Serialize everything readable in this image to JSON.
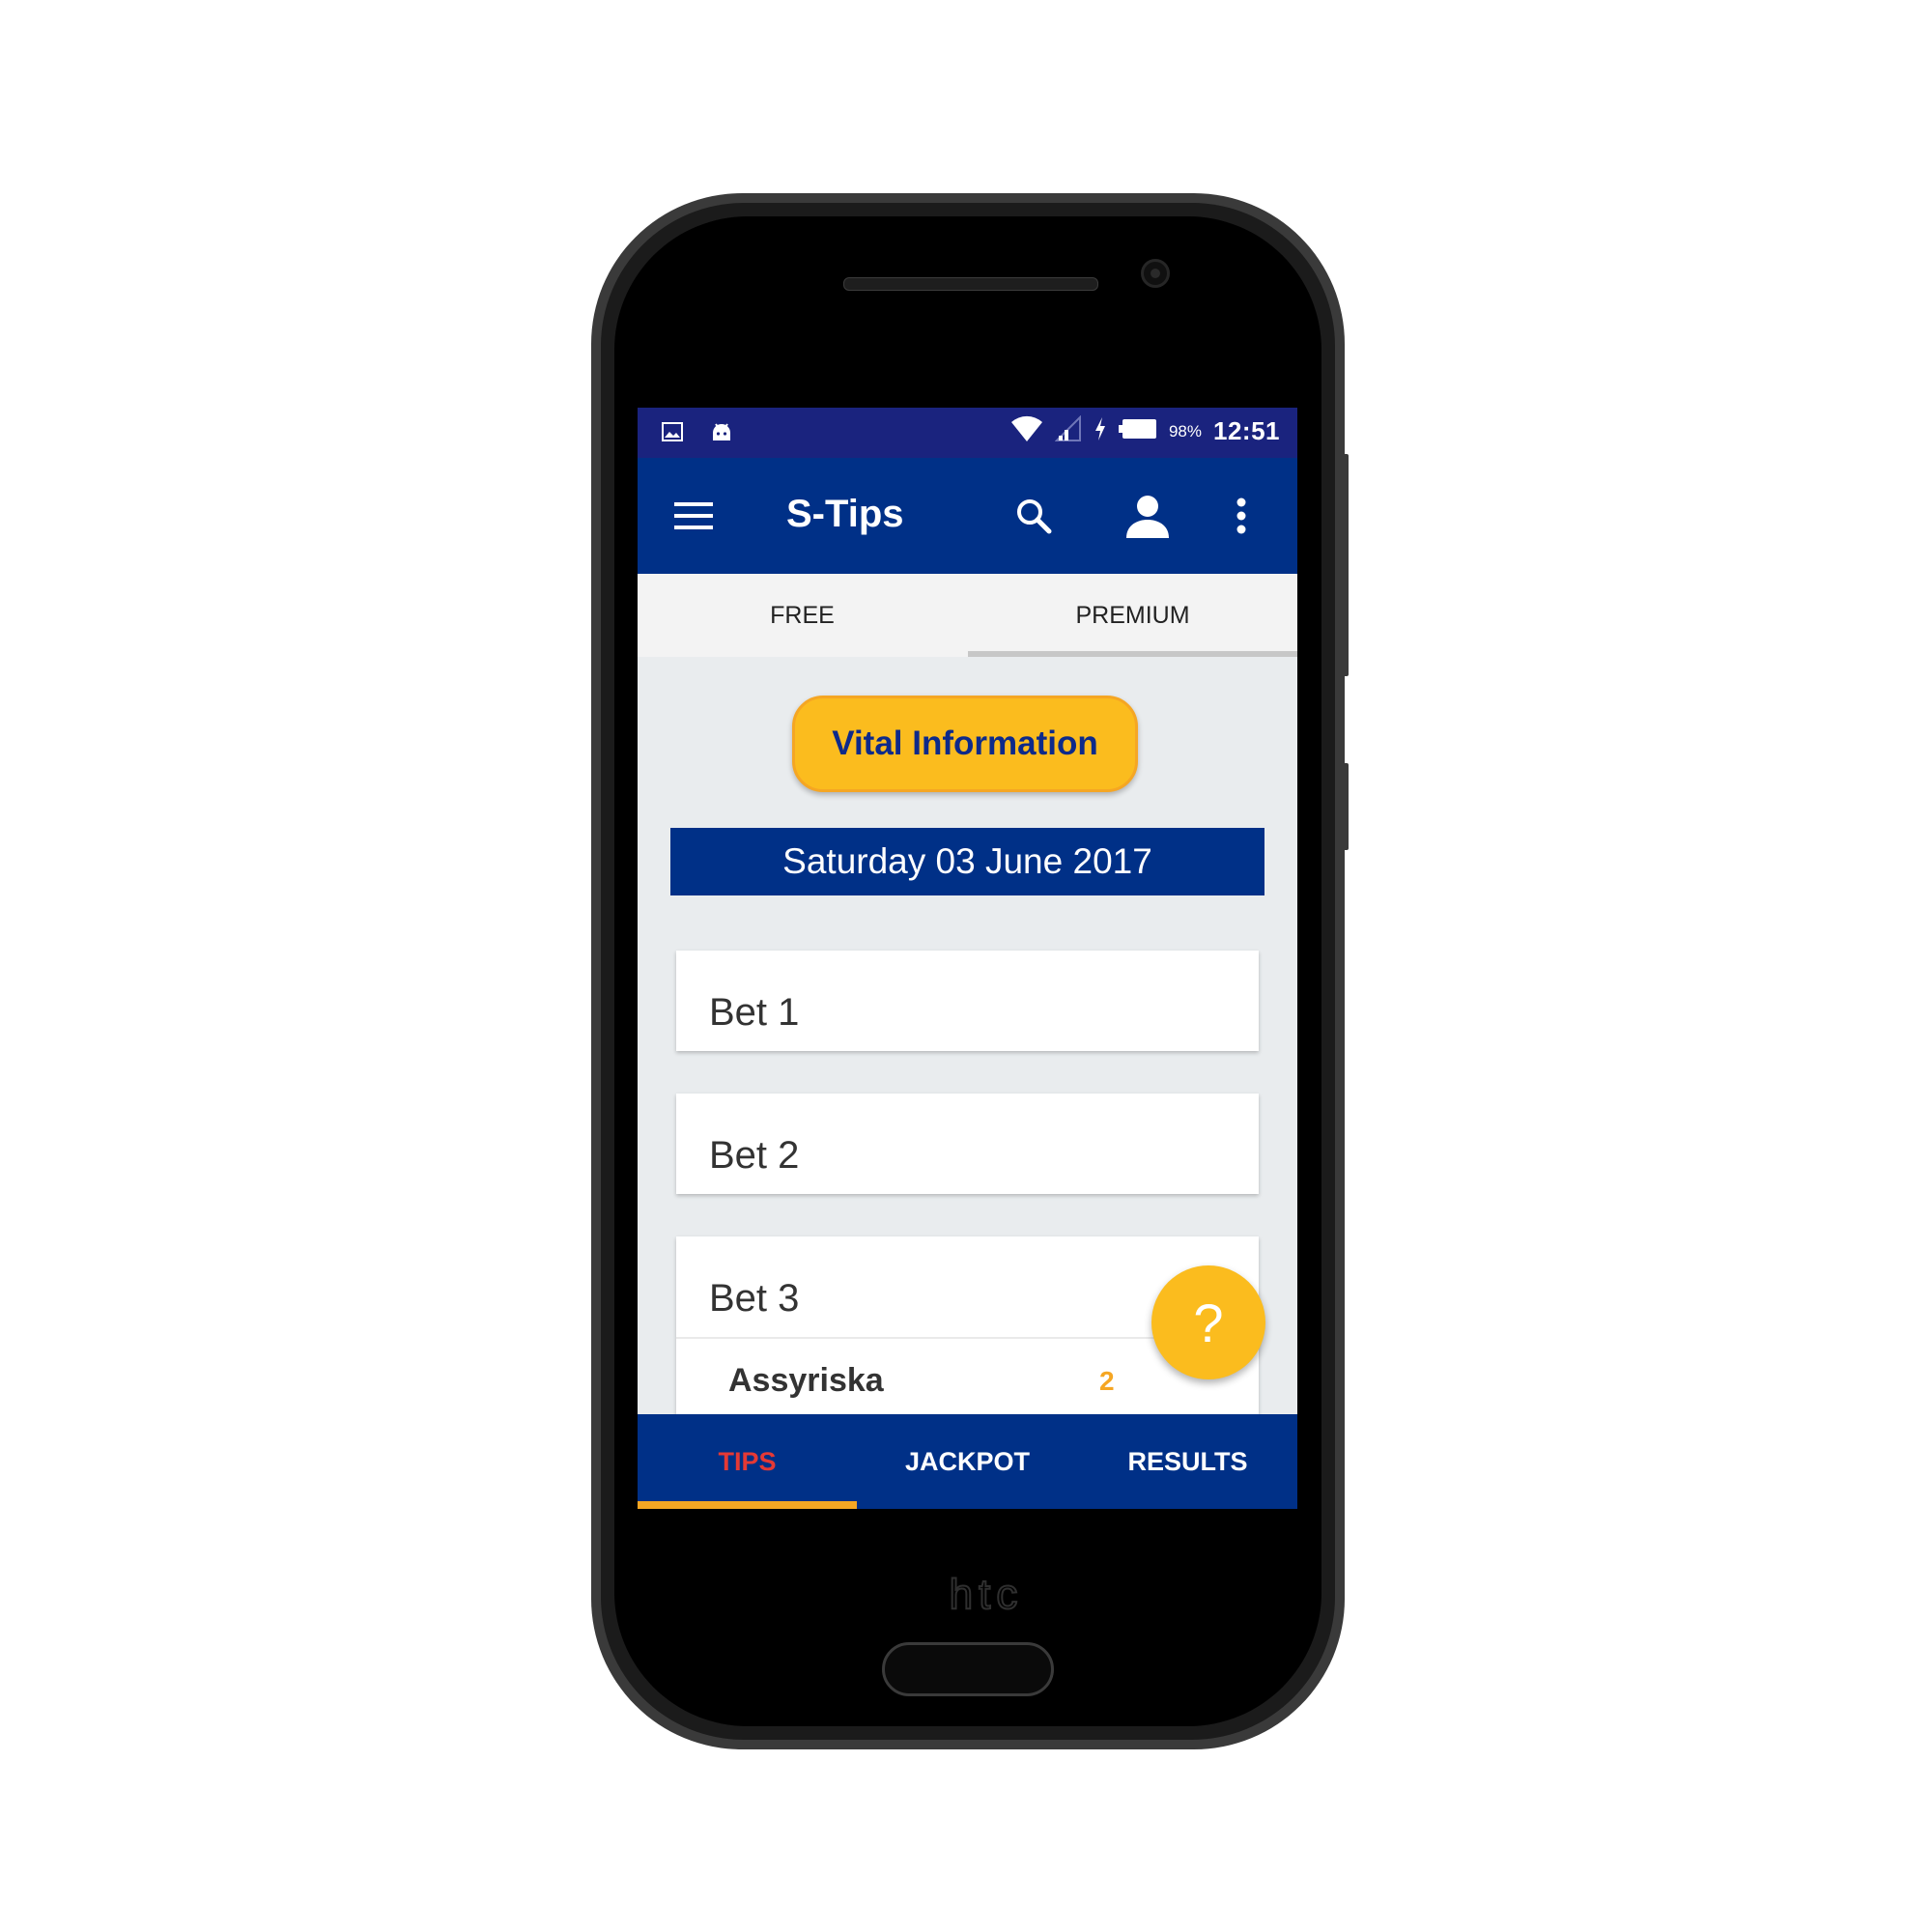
{
  "device": {
    "brand": "htc"
  },
  "status_bar": {
    "left_icons": [
      "image-icon",
      "android-icon"
    ],
    "wifi_icon": "wifi-icon",
    "signal_icon": "signal-icon",
    "charging_icon": "lightning-icon",
    "battery_icon": "battery-icon",
    "battery_percent": "98%",
    "battery_level": 0.98,
    "time": "12:51"
  },
  "app_bar": {
    "menu_icon": "hamburger-menu-icon",
    "title": "S-Tips",
    "search_icon": "search-icon",
    "account_icon": "account-icon",
    "overflow_icon": "more-vertical-icon"
  },
  "tabs": {
    "items": [
      {
        "label": "FREE",
        "selected": false
      },
      {
        "label": "PREMIUM",
        "selected": true
      }
    ]
  },
  "main": {
    "vital_button_label": "Vital Information",
    "date": "Saturday 03 June 2017",
    "bets": [
      {
        "label": "Bet 1"
      },
      {
        "label": "Bet 2"
      },
      {
        "label": "Bet 3",
        "match": {
          "team": "Assyriska",
          "pick": "2"
        }
      }
    ]
  },
  "fab": {
    "icon": "help-question-icon",
    "label": "?"
  },
  "bottom_nav": {
    "items": [
      {
        "label": "TIPS",
        "selected": true
      },
      {
        "label": "JACKPOT",
        "selected": false
      },
      {
        "label": "RESULTS",
        "selected": false
      }
    ]
  },
  "colors": {
    "status_bar": "#1a237e",
    "primary": "#003087",
    "accent": "#fbbc1e",
    "selected_nav_text": "#e53935",
    "pick_text": "#f5a623"
  }
}
